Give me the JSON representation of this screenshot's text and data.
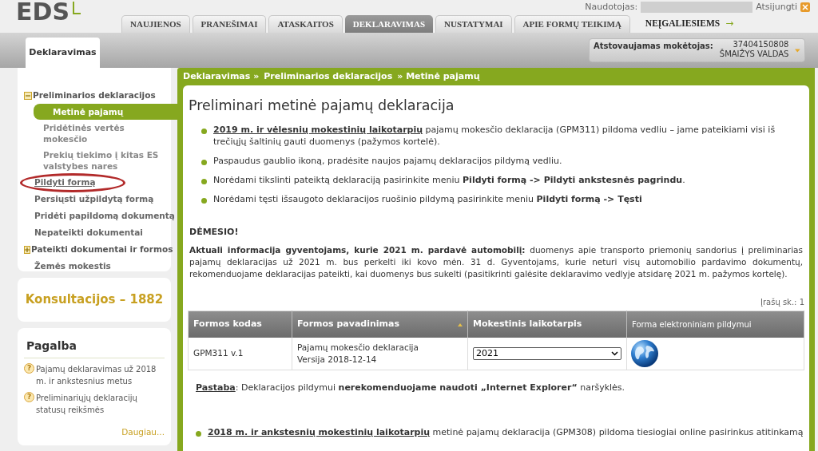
{
  "logo": "EDS",
  "user": {
    "label": "Naudotojas:",
    "logout": "Atsijungti"
  },
  "tabs": [
    {
      "label": "NAUJIENOS",
      "selected": false
    },
    {
      "label": "PRANEŠIMAI",
      "selected": false
    },
    {
      "label": "ATASKAITOS",
      "selected": false
    },
    {
      "label": "DEKLARAVIMAS",
      "selected": true
    },
    {
      "label": "NUSTATYMAI",
      "selected": false
    },
    {
      "label": "APIE FORMŲ TEIKIMĄ",
      "selected": false
    }
  ],
  "accessibility_link": "NEĮGALIESIEMS",
  "accessibility_arrow": "→",
  "help_mark": "?",
  "subtab": "Deklaravimas",
  "taxpayer": {
    "label": "Atstovaujamas mokėtojas:",
    "code": "37404150808",
    "name": "ŠMAIŽYS VALDAS"
  },
  "sidebar": {
    "items": [
      {
        "kind": "group",
        "label": "Preliminarios deklaracijos",
        "expanded": true,
        "children": [
          {
            "label": "Metinė pajamų",
            "selected": true
          },
          {
            "label": "Pridėtinės vertės mokesčio",
            "selected": false
          },
          {
            "label": "Prekių tiekimo į kitas ES valstybes nares",
            "selected": false
          }
        ]
      },
      {
        "kind": "link",
        "label": "Pildyti formą",
        "hovered": true,
        "circled": true
      },
      {
        "kind": "link",
        "label": "Persiųsti užpildytą formą",
        "hovered": false,
        "circled": false
      },
      {
        "kind": "link",
        "label": "Pridėti papildomą dokumentą",
        "hovered": false,
        "circled": false
      },
      {
        "kind": "link",
        "label": "Nepateikti dokumentai",
        "hovered": false,
        "circled": false
      },
      {
        "kind": "group",
        "label": "Pateikti dokumentai ir formos",
        "expanded": false
      },
      {
        "kind": "link",
        "label": "Žemės mokestis",
        "hovered": false,
        "circled": false
      }
    ]
  },
  "consultation": "Konsultacijos – 1882",
  "help": {
    "title": "Pagalba",
    "items": [
      "Pajamų deklaravimas už 2018 m. ir ankstesnius metus",
      "Preliminariųjų deklaracijų statusų reikšmės"
    ],
    "more": "Daugiau..."
  },
  "breadcrumb": [
    "Deklaravimas »",
    "Preliminarios deklaracijos",
    "» Metinė pajamų"
  ],
  "title": "Preliminari metinė pajamų deklaracija",
  "bullets": [
    {
      "link": "2019 m. ir vėlesnių mokestinių laikotarpių",
      "text": " pajamų mokesčio deklaracija (GPM311) pildoma vedliu – jame pateikiami visi iš trečiųjų šaltinių gauti duomenys (pažymos kortelė)."
    },
    {
      "text": "Paspaudus gaublio ikoną, pradėsite naujos pajamų deklaracijos pildymą vedliu."
    },
    {
      "text": "Norėdami tikslinti pateiktą deklaraciją pasirinkite meniu **Pildyti formą -> Pildyti ankstesnės pagrindu**."
    },
    {
      "text": "Norėdami tęsti išsaugoto deklaracijos ruošinio pildymą pasirinkite meniu **Pildyti formą -> Tęsti**"
    }
  ],
  "notice": {
    "title": "DĖMESIO!",
    "text": "**Aktuali informacija gyventojams, kurie 2021 m. pardavė automobilį:** duomenys apie transporto priemonių sandorius į preliminarias pajamų deklaracijas už 2021 m. bus perkelti iki kovo mėn. 31 d. Gyventojams, kurie neturi visų automobilio pardavimo dokumentų, rekomenduojame deklaracijas pateikti, kai duomenys bus sukelti (pasitikrinti galėsite deklaravimo vedlyje atsidarę 2021 m. pažymos kortelę)."
  },
  "record_count": "Įrašų sk.: 1",
  "table": {
    "columns": [
      {
        "label": "Formos kodas",
        "sorted": false
      },
      {
        "label": "Formos pavadinimas",
        "sorted": true
      },
      {
        "label": "Mokestinis laikotarpis",
        "sorted": false
      },
      {
        "label": "Forma elektroniniam pildymui",
        "sorted": false
      }
    ],
    "rows": [
      {
        "code": "GPM311 v.1",
        "name": [
          "Pajamų mokesčio deklaracija",
          "Versija 2018-12-14"
        ],
        "period": "2021"
      }
    ]
  },
  "note": {
    "link": "Pastaba",
    "text": ": Deklaracijos pildymui **nerekomenduojame naudoti „Internet Explorer“** naršyklės."
  },
  "bottom_bullet": {
    "link": "2018 m. ir ankstesnių mokestinių laikotarpių",
    "text": " metinė pajamų deklaracija (GPM308) pildoma tiesiogiai online pasirinkus atitinkamą"
  }
}
